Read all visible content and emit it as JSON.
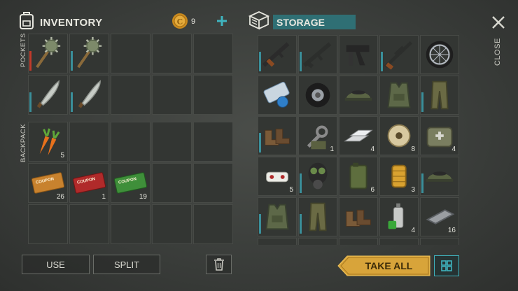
{
  "inventory": {
    "title": "INVENTORY",
    "currency_amount": "9",
    "pockets_label": "POCKETS",
    "backpack_label": "BACKPACK",
    "pockets": [
      {
        "icon": "spiked-mace-icon",
        "count": "",
        "bar": "red"
      },
      {
        "icon": "spiked-mace-icon",
        "count": "",
        "bar": "teal"
      },
      {
        "icon": "",
        "count": ""
      },
      {
        "icon": "",
        "count": ""
      },
      {
        "icon": "",
        "count": ""
      },
      {
        "icon": "machete-icon",
        "count": "",
        "bar": "teal"
      },
      {
        "icon": "machete-icon",
        "count": "",
        "bar": "teal"
      },
      {
        "icon": "",
        "count": ""
      },
      {
        "icon": "",
        "count": ""
      },
      {
        "icon": "",
        "count": ""
      }
    ],
    "backpack": [
      {
        "icon": "carrot-icon",
        "count": "5"
      },
      {
        "icon": "",
        "count": ""
      },
      {
        "icon": "",
        "count": ""
      },
      {
        "icon": "",
        "count": ""
      },
      {
        "icon": "",
        "count": ""
      },
      {
        "icon": "coupon-orange-icon",
        "count": "26",
        "text": "COUPON"
      },
      {
        "icon": "coupon-red-icon",
        "count": "1",
        "text": "COUPON"
      },
      {
        "icon": "coupon-green-icon",
        "count": "19",
        "text": "COUPON"
      },
      {
        "icon": "",
        "count": ""
      },
      {
        "icon": "",
        "count": ""
      },
      {
        "icon": "",
        "count": ""
      },
      {
        "icon": "",
        "count": ""
      },
      {
        "icon": "",
        "count": ""
      },
      {
        "icon": "",
        "count": ""
      },
      {
        "icon": "",
        "count": ""
      }
    ],
    "use_label": "USE",
    "split_label": "SPLIT"
  },
  "storage": {
    "title": "STORAGE",
    "close_label": "CLOSE",
    "take_all_label": "TAKE ALL",
    "items": [
      {
        "icon": "assault-rifle-icon",
        "count": "",
        "bar": "teal"
      },
      {
        "icon": "rifle-icon",
        "count": "",
        "bar": "teal"
      },
      {
        "icon": "pistol-icon",
        "count": ""
      },
      {
        "icon": "sniper-rifle-icon",
        "count": "",
        "bar": "teal"
      },
      {
        "icon": "wheel-icon",
        "count": ""
      },
      {
        "icon": "blueprint-scroll-icon",
        "count": ""
      },
      {
        "icon": "tire-icon",
        "count": ""
      },
      {
        "icon": "camo-cap-icon",
        "count": ""
      },
      {
        "icon": "camo-vest-icon",
        "count": ""
      },
      {
        "icon": "camo-pants-icon",
        "count": "",
        "bar": "teal"
      },
      {
        "icon": "boots-icon",
        "count": "",
        "bar": "teal"
      },
      {
        "icon": "wrench-parts-icon",
        "count": "1"
      },
      {
        "icon": "metal-ingots-icon",
        "count": "4"
      },
      {
        "icon": "wire-spool-icon",
        "count": "8"
      },
      {
        "icon": "medic-bag-icon",
        "count": "4"
      },
      {
        "icon": "bandage-icon",
        "count": "5"
      },
      {
        "icon": "gas-mask-icon",
        "count": "",
        "bar": "teal"
      },
      {
        "icon": "jerrycan-icon",
        "count": "6"
      },
      {
        "icon": "fuel-filter-icon",
        "count": "3"
      },
      {
        "icon": "camo-cap-icon",
        "count": "",
        "bar": "teal"
      },
      {
        "icon": "camo-vest-icon",
        "count": "",
        "bar": "teal"
      },
      {
        "icon": "camo-pants-icon",
        "count": "",
        "bar": "teal"
      },
      {
        "icon": "boots-icon",
        "count": ""
      },
      {
        "icon": "spray-can-icon",
        "count": "4"
      },
      {
        "icon": "metal-plate-icon",
        "count": "16"
      }
    ]
  },
  "colors": {
    "accent": "#2f6f74",
    "take_all": "#d8a43a",
    "teal_bar": "#3a8f9a",
    "red_bar": "#c23a2a"
  }
}
